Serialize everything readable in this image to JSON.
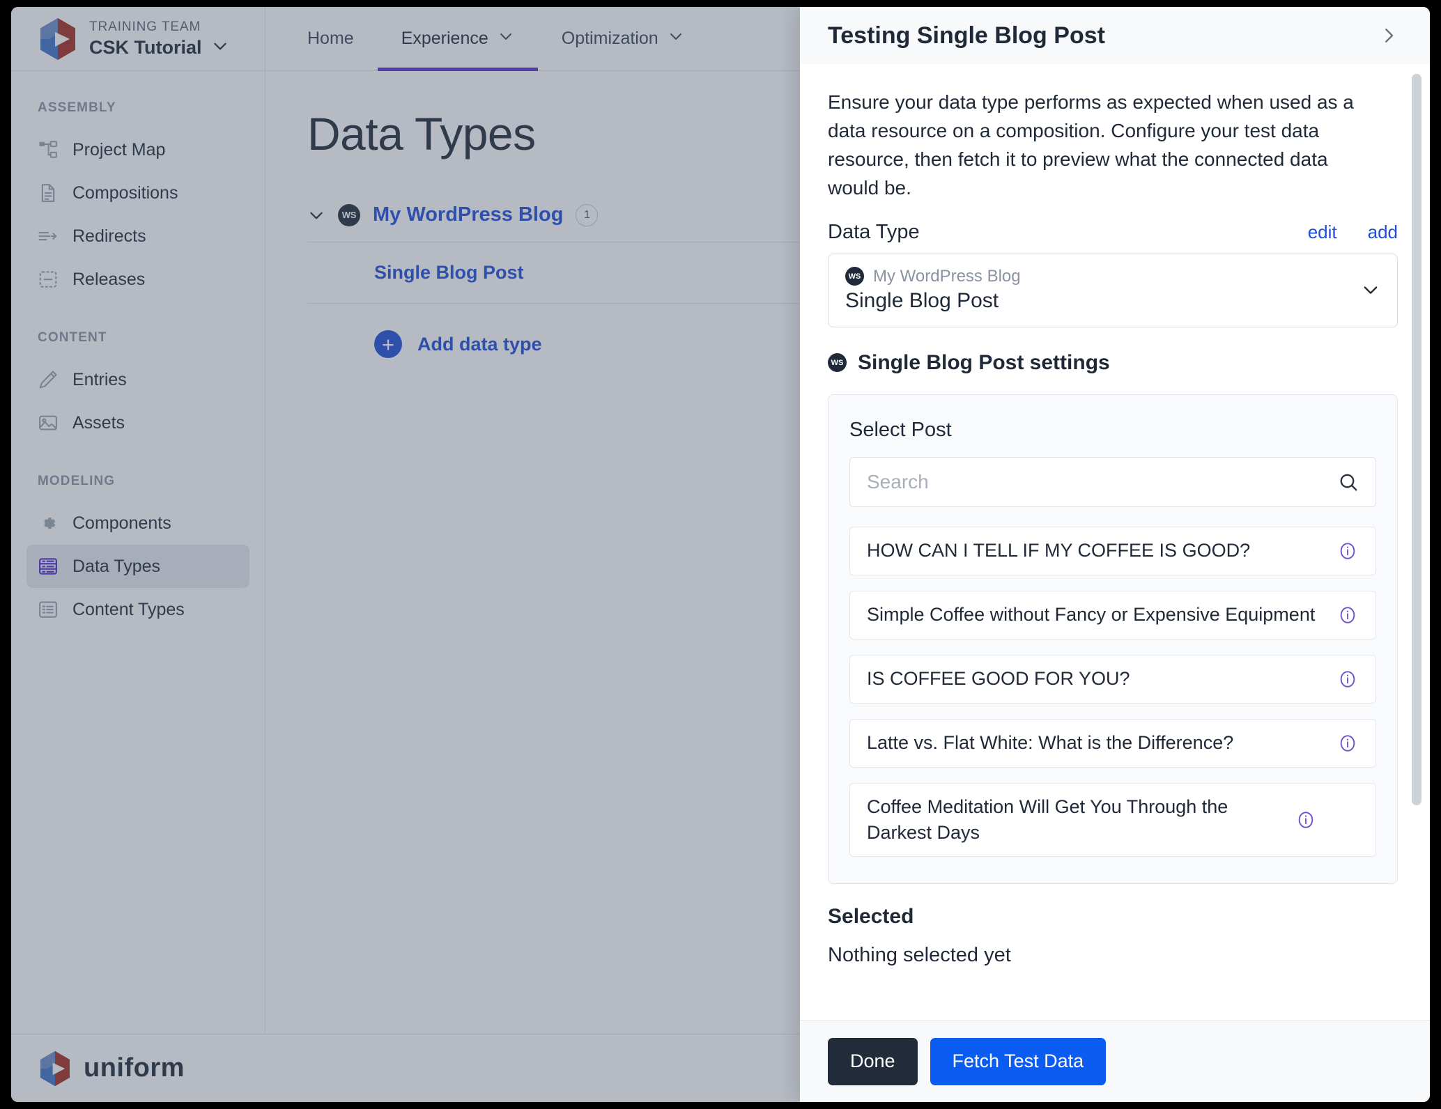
{
  "brand": {
    "team_label": "TRAINING TEAM",
    "project_name": "CSK Tutorial",
    "caret_icon": "chevron-down-icon",
    "logo_icon": "uniform-logo-icon"
  },
  "topnav": {
    "items": [
      {
        "label": "Home",
        "has_caret": false,
        "active": false
      },
      {
        "label": "Experience",
        "has_caret": true,
        "active": true
      },
      {
        "label": "Optimization",
        "has_caret": true,
        "active": false
      }
    ]
  },
  "sidebar": {
    "groups": [
      {
        "label": "ASSEMBLY",
        "items": [
          {
            "label": "Project Map",
            "icon": "project-map-icon",
            "selected": false
          },
          {
            "label": "Compositions",
            "icon": "document-icon",
            "selected": false
          },
          {
            "label": "Redirects",
            "icon": "redirect-arrow-icon",
            "selected": false
          },
          {
            "label": "Releases",
            "icon": "release-box-icon",
            "selected": false
          }
        ]
      },
      {
        "label": "CONTENT",
        "items": [
          {
            "label": "Entries",
            "icon": "pencil-icon",
            "selected": false
          },
          {
            "label": "Assets",
            "icon": "image-icon",
            "selected": false
          }
        ]
      },
      {
        "label": "MODELING",
        "items": [
          {
            "label": "Components",
            "icon": "gear-icon",
            "selected": false
          },
          {
            "label": "Data Types",
            "icon": "data-types-icon",
            "selected": true
          },
          {
            "label": "Content Types",
            "icon": "content-types-icon",
            "selected": false
          }
        ]
      }
    ]
  },
  "main": {
    "page_title": "Data Types",
    "data_source": {
      "caret_icon": "chevron-down-icon",
      "badge": "WS",
      "name": "My WordPress Blog",
      "count": "1"
    },
    "data_types": [
      {
        "name": "Single Blog Post"
      }
    ],
    "add_label": "Add data type",
    "add_icon": "plus-circle-icon"
  },
  "footer": {
    "wordmark": "uniform",
    "logo_icon": "uniform-logo-icon"
  },
  "panel": {
    "title": "Testing Single Blog Post",
    "close_icon": "chevron-right-icon",
    "description": "Ensure your data type performs as expected when used as a data resource on a composition. Configure your test data resource, then fetch it to preview what the connected data would be.",
    "data_type_field": {
      "label": "Data Type",
      "edit_label": "edit",
      "add_label": "add",
      "badge": "WS",
      "source_name": "My WordPress Blog",
      "selected_value": "Single Blog Post",
      "caret_icon": "chevron-down-icon"
    },
    "settings": {
      "badge": "WS",
      "title": "Single Blog Post settings",
      "card_label": "Select Post",
      "search": {
        "value": "",
        "placeholder": "Search",
        "icon": "search-icon"
      },
      "posts": [
        {
          "title": "HOW CAN I TELL IF MY COFFEE IS GOOD?",
          "info_icon": "info-icon"
        },
        {
          "title": "Simple Coffee without Fancy or Expensive Equipment",
          "info_icon": "info-icon"
        },
        {
          "title": "IS COFFEE GOOD FOR YOU?",
          "info_icon": "info-icon"
        },
        {
          "title": "Latte vs. Flat White: What is the Difference?",
          "info_icon": "info-icon"
        },
        {
          "title": "Coffee Meditation Will Get You Through the Darkest Days",
          "info_icon": "info-icon"
        }
      ]
    },
    "selected": {
      "heading": "Selected",
      "empty_text": "Nothing selected yet"
    },
    "actions": {
      "done_label": "Done",
      "fetch_label": "Fetch Test Data"
    }
  },
  "colors": {
    "accent_blue": "#1d4ed8",
    "primary_button": "#0b5cf0",
    "dark_button": "#222b39",
    "purple_accent": "#5b2fd4",
    "info_purple": "#6d4fd0"
  }
}
